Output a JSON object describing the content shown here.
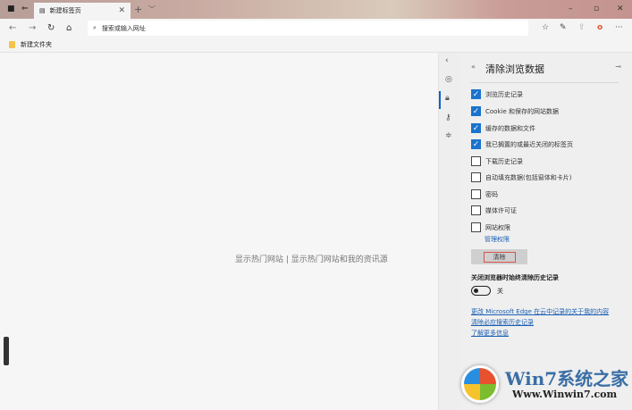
{
  "tab": {
    "title": "新建标签页"
  },
  "address": {
    "placeholder": "搜索或输入网址"
  },
  "favorites": [
    {
      "label": "新建文件夹"
    }
  ],
  "main": {
    "message": "显示热门网站 | 显示热门网站和我的资讯源"
  },
  "panel": {
    "title": "清除浏览数据",
    "items": [
      {
        "label": "浏览历史记录",
        "checked": true
      },
      {
        "label": "Cookie 和保存的网站数据",
        "checked": true
      },
      {
        "label": "缓存的数据和文件",
        "checked": true
      },
      {
        "label": "我已搁置的或最近关闭的标签页",
        "checked": true
      },
      {
        "label": "下载历史记录",
        "checked": false
      },
      {
        "label": "自动填充数据(包括窗体和卡片)",
        "checked": false
      },
      {
        "label": "密码",
        "checked": false
      },
      {
        "label": "媒体许可证",
        "checked": false
      },
      {
        "label": "网站权限",
        "checked": false
      }
    ],
    "manage_permissions": "管理权限",
    "clear_button": "清除",
    "always_clear_heading": "关闭浏览器时始终清除历史记录",
    "toggle_state": "关",
    "links": [
      "更改 Microsoft Edge 在云中记录的关于我的内容",
      "清除必应搜索历史记录",
      "了解更多信息"
    ]
  },
  "watermark": {
    "brand": "Win7系统之家",
    "url": "Www.Winwin7.com"
  },
  "colors": {
    "accent": "#1a73cc",
    "link": "#1a5fb4",
    "clear_outline": "#d9534f"
  }
}
